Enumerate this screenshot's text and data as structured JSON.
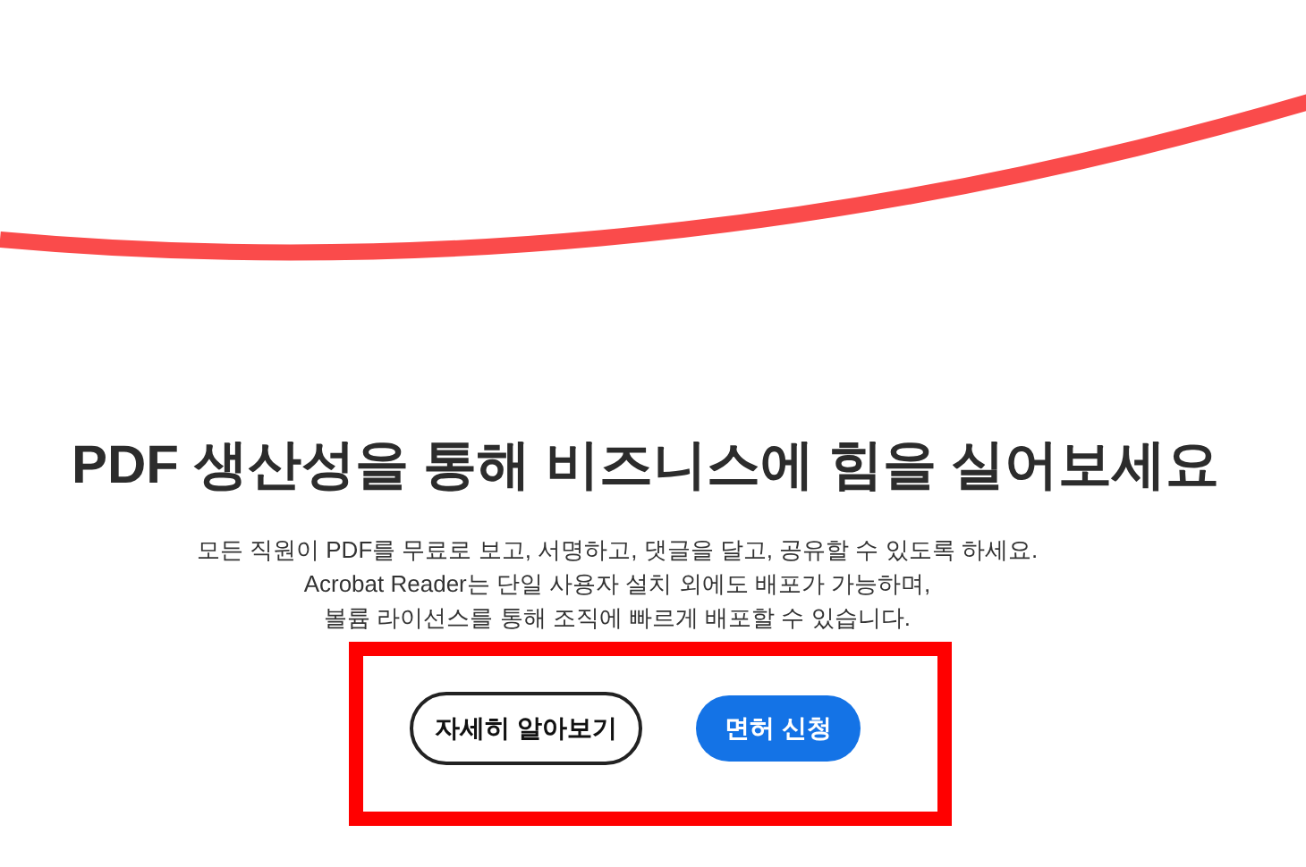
{
  "heading": "PDF 생산성을 통해 비즈니스에 힘을 실어보세요",
  "description": [
    "모든 직원이 PDF를 무료로 보고, 서명하고, 댓글을 달고, 공유할 수 있도록 하세요.",
    "Acrobat Reader는 단일 사용자 설치 외에도 배포가 가능하며,",
    "볼륨 라이선스를 통해 조직에 빠르게 배포할 수 있습니다."
  ],
  "buttons": [
    {
      "label": "자세히 알아보기",
      "kind": "outline"
    },
    {
      "label": "면허 신청",
      "kind": "filled"
    }
  ]
}
